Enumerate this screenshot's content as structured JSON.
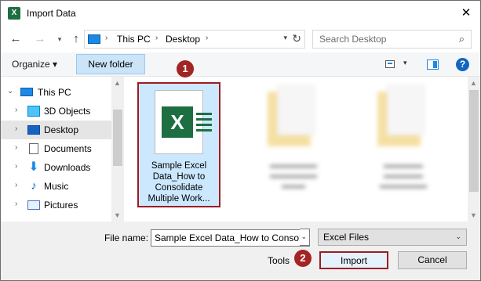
{
  "window": {
    "title": "Import Data",
    "app_icon_letter": "X"
  },
  "address": {
    "crumbs": [
      "This PC",
      "Desktop"
    ],
    "search_placeholder": "Search Desktop"
  },
  "toolbar": {
    "organize_label": "Organize ▾",
    "new_folder_label": "New folder",
    "help_label": "?"
  },
  "nav": {
    "items": [
      {
        "label": "This PC",
        "icon": "computer-icon"
      },
      {
        "label": "3D Objects",
        "icon": "cube-icon"
      },
      {
        "label": "Desktop",
        "icon": "desktop-icon",
        "selected": true
      },
      {
        "label": "Documents",
        "icon": "document-icon"
      },
      {
        "label": "Downloads",
        "icon": "download-icon"
      },
      {
        "label": "Music",
        "icon": "music-icon"
      },
      {
        "label": "Pictures",
        "icon": "picture-icon"
      }
    ]
  },
  "files": {
    "selected": {
      "name": "Sample Excel Data_How to Consolidate Multiple Work...",
      "name_lines": [
        "Sample Excel",
        "Data_How to",
        "Consolidate",
        "Multiple Work..."
      ],
      "icon_letter": "X"
    }
  },
  "steps": {
    "one": "1",
    "two": "2"
  },
  "bottom": {
    "file_name_label": "File name:",
    "file_name_value": "Sample Excel Data_How to Consol",
    "file_type_value": "Excel Files",
    "tools_label": "Tools",
    "import_label": "Import",
    "cancel_label": "Cancel"
  },
  "colors": {
    "excel_green": "#1d6f42",
    "highlight_border": "#9e1c24",
    "step_badge": "#a32424",
    "selection": "#cce8ff"
  }
}
